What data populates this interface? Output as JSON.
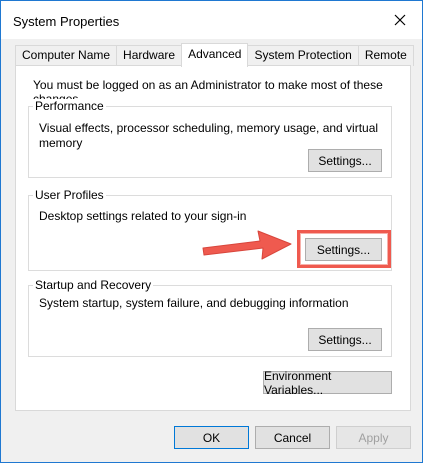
{
  "window": {
    "title": "System Properties"
  },
  "tabs": [
    {
      "label": "Computer Name"
    },
    {
      "label": "Hardware"
    },
    {
      "label": "Advanced"
    },
    {
      "label": "System Protection"
    },
    {
      "label": "Remote"
    }
  ],
  "active_tab": "Advanced",
  "intro_text": "You must be logged on as an Administrator to make most of these changes.",
  "groups": {
    "performance": {
      "title": "Performance",
      "description_line1": "Visual effects, processor scheduling, memory usage, and virtual",
      "description_line2": "memory",
      "button": "Settings..."
    },
    "user_profiles": {
      "title": "User Profiles",
      "description": "Desktop settings related to your sign-in",
      "button": "Settings..."
    },
    "startup_recovery": {
      "title": "Startup and Recovery",
      "description": "System startup, system failure, and debugging information",
      "button": "Settings..."
    }
  },
  "env_button": "Environment Variables...",
  "footer": {
    "ok": "OK",
    "cancel": "Cancel",
    "apply": "Apply"
  },
  "colors": {
    "annotation": "#ef5a4f",
    "accent": "#0078d7"
  }
}
